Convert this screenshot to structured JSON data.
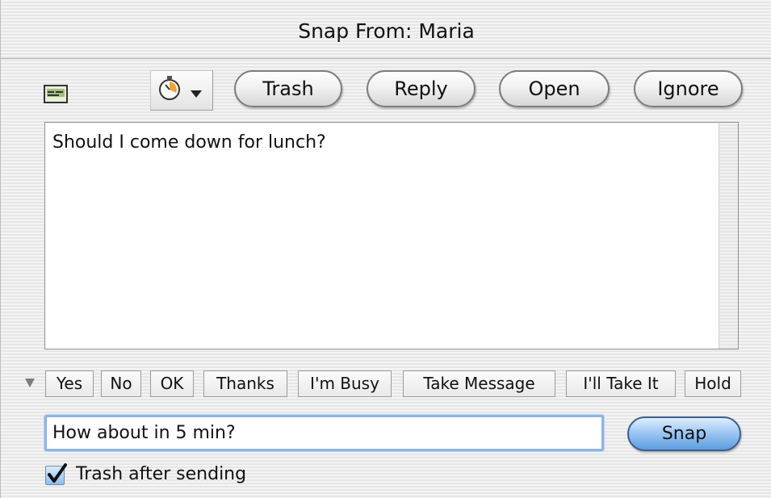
{
  "window": {
    "title": "Snap From: Maria"
  },
  "toolbar": {
    "buttons": [
      {
        "label": "Trash"
      },
      {
        "label": "Reply"
      },
      {
        "label": "Open"
      },
      {
        "label": "Ignore"
      }
    ],
    "icons": {
      "left": "message-card-icon",
      "timer": "stopwatch-icon",
      "popup_arrow": "triangle-down-icon"
    }
  },
  "message": {
    "text": "Should I come down for lunch?"
  },
  "quick_replies": [
    "Yes",
    "No",
    "OK",
    "Thanks",
    "I'm Busy",
    "Take Message",
    "I'll Take It",
    "Hold"
  ],
  "reply": {
    "value": "How about in 5 min?",
    "send_label": "Snap"
  },
  "options": {
    "trash_after_sending_label": "Trash after sending",
    "trash_after_sending_checked": true
  },
  "colors": {
    "accent": "#5d9de0",
    "focus": "#8fb5e2"
  }
}
